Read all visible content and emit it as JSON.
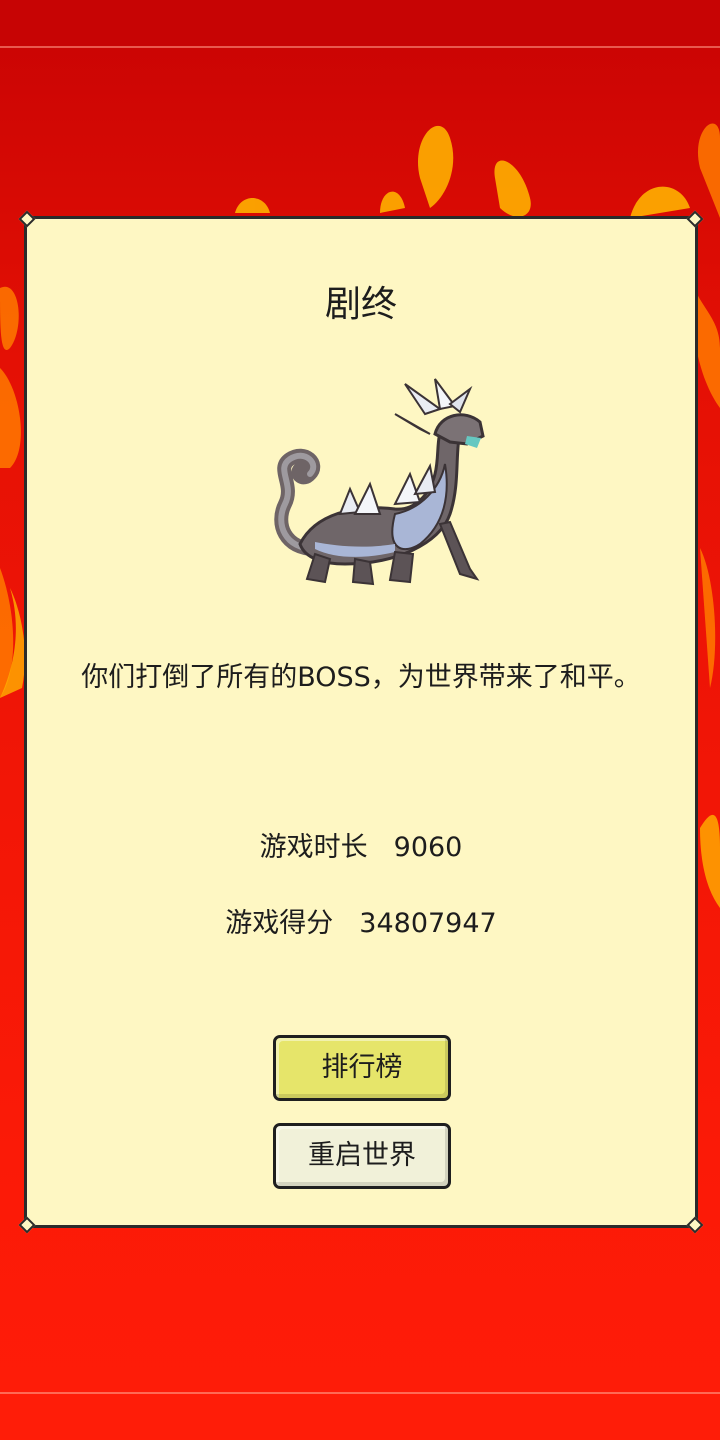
{
  "dialog": {
    "title": "剧终",
    "message": "你们打倒了所有的BOSS，为世界带来了和平。",
    "stats": {
      "time_label": "游戏时长",
      "time_value": "9060",
      "score_label": "游戏得分",
      "score_value": "34807947"
    },
    "buttons": {
      "leaderboard": "排行榜",
      "restart": "重启世界"
    }
  },
  "colors": {
    "background": "#f21606",
    "dialog_bg": "#fef7c3",
    "leaderboard_button": "#e6e56a",
    "restart_button": "#f1f1d9"
  },
  "icons": [
    "dragon-boss-sprite",
    "flame-background"
  ]
}
